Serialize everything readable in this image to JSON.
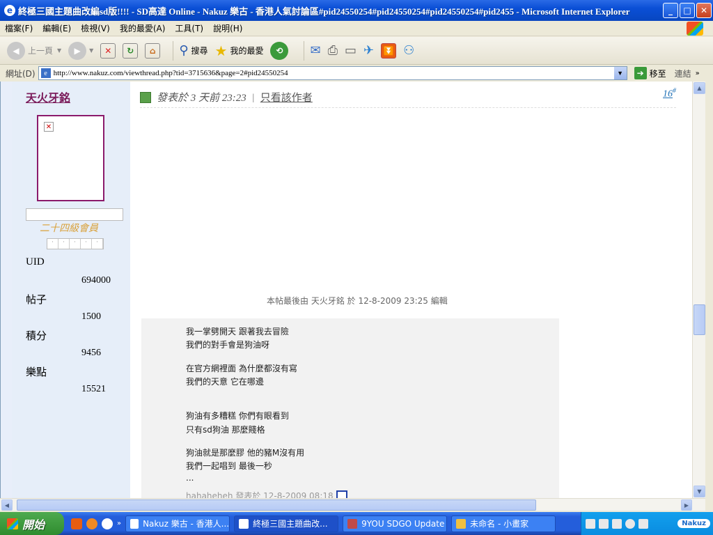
{
  "window": {
    "title": "終極三國主題曲改編sd版!!!! - SD高達 Online - Nakuz 樂古 - 香港人氣討論區#pid24550254#pid24550254#pid24550254#pid2455 - Microsoft Internet Explorer",
    "ie_icon": "e",
    "min_glyph": "_",
    "max_glyph": "□",
    "close_glyph": "✕"
  },
  "menu": [
    "檔案(F)",
    "編輯(E)",
    "檢視(V)",
    "我的最愛(A)",
    "工具(T)",
    "說明(H)"
  ],
  "toolbar": {
    "back_label": "上一頁",
    "search_label": "搜尋",
    "favorites_label": "我的最愛"
  },
  "address": {
    "label": "網址(D)",
    "url": "http://www.nakuz.com/viewthread.php?tid=3715636&page=2#pid24550254",
    "go_label": "移至",
    "links_label": "連結"
  },
  "sidebar": {
    "username": "天火牙銘",
    "rank": "二十四級會員",
    "stats": [
      {
        "label": "UID",
        "value": "694000"
      },
      {
        "label": "帖子",
        "value": "1500"
      },
      {
        "label": "積分",
        "value": "9456"
      },
      {
        "label": "樂點",
        "value": "15521"
      }
    ]
  },
  "post": {
    "posted": "發表於 3 天前 23:23",
    "only_author": "只看該作者",
    "floor": "16",
    "floor_mark": "#",
    "edit_note": "本帖最後由 天火牙銘 於 12-8-2009 23:25 編輯",
    "lines": [
      "我一掌劈開天 跟著我去冒險",
      "我們的對手會是狗油呀",
      "在官方網裡面 為什麼都沒有寫",
      "我們的天意 它在哪邊",
      "狗油有多糟糕 你們有眼看到",
      "只有sd狗油 那麼賤格",
      "狗油就是那麼膠 他的豬M沒有用",
      "我們一起唱到 最後一秒",
      "..."
    ],
    "signature": "hahaheheh 發表於 12-8-2009 08:18"
  },
  "taskbar": {
    "start_label": "開始",
    "tasks": [
      "Nakuz 樂古 - 香港人...",
      "終極三國主題曲改...",
      "9YOU SDGO Update",
      "未命名 - 小畫家"
    ],
    "tray_badge": "Nakuz"
  }
}
